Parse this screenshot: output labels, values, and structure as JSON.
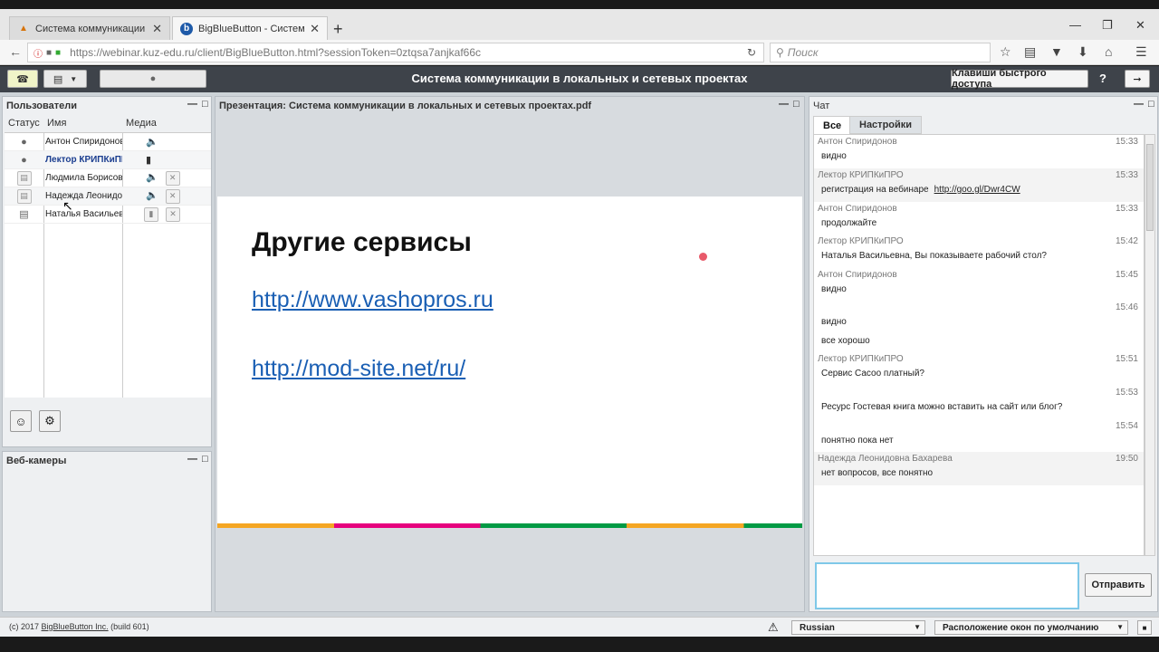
{
  "browser": {
    "tabs": [
      {
        "title": "Система коммуникации ...",
        "favicon": "flame-icon"
      },
      {
        "title": "BigBlueButton - Система ...",
        "favicon": "b-icon"
      }
    ],
    "url": "https://webinar.kuz-edu.ru/client/BigBlueButton.html?sessionToken=0ztqsa7anjkaf66c",
    "search_placeholder": "Поиск"
  },
  "app": {
    "conference_title": "Система коммуникации в локальных и сетевых проектах",
    "shortcuts_label": "Клавиши быстрого доступа",
    "help_label": "?"
  },
  "users": {
    "title": "Пользователи",
    "col_status": "Статус",
    "col_name": "Имя",
    "col_media": "Медиа",
    "rows": [
      {
        "name": "Антон Спиридонов"
      },
      {
        "name": "Лектор КРИПКиПРО"
      },
      {
        "name": "Людмила Борисовн"
      },
      {
        "name": "Надежда Леонидов"
      },
      {
        "name": "Наталья Васильевн"
      }
    ]
  },
  "webcams": {
    "title": "Веб-камеры"
  },
  "presentation": {
    "title": "Презентация: Система коммуникации в локальных и сетевых проектах.pdf",
    "slide_heading": "Другие сервисы",
    "link1": "http://www.vashopros.ru",
    "link2": "http://mod-site.net/ru/"
  },
  "chat": {
    "title": "Чат",
    "tab_all": "Все",
    "tab_settings": "Настройки",
    "send_label": "Отправить",
    "messages": [
      {
        "sender": "Антон Спиридонов",
        "time": "15:33",
        "text": "видно"
      },
      {
        "sender": "Лектор КРИПКиПРО",
        "time": "15:33",
        "text": "регистрация на вебинаре",
        "link": "http://goo.gl/Dwr4CW"
      },
      {
        "sender": "Антон Спиридонов",
        "time": "15:33",
        "text": "продолжайте"
      },
      {
        "sender": "Лектор КРИПКиПРО",
        "time": "15:42",
        "text": "Наталья Васильевна, Вы показываете рабочий стол?"
      },
      {
        "sender": "Антон Спиридонов",
        "time": "15:45",
        "text": "видно"
      },
      {
        "sender": "",
        "time": "15:46",
        "text": "видно"
      },
      {
        "sender": "",
        "time": "",
        "text": "все хорошо"
      },
      {
        "sender": "Лектор КРИПКиПРО",
        "time": "15:51",
        "text": "Сервис Сасоо платный?"
      },
      {
        "sender": "",
        "time": "15:53",
        "text": "Ресурс Гостевая книга можно вставить на сайт или блог?"
      },
      {
        "sender": "",
        "time": "15:54",
        "text": "понятно пока нет"
      },
      {
        "sender": "Надежда Леонидовна Бахарева",
        "time": "19:50",
        "text": "нет вопросов, все понятно"
      }
    ]
  },
  "footer": {
    "copyright_prefix": "(c) 2017",
    "copyright_link": "BigBlueButton Inc.",
    "copyright_suffix": "(build 601)",
    "language": "Russian",
    "layout": "Расположение окон по умолчанию"
  }
}
